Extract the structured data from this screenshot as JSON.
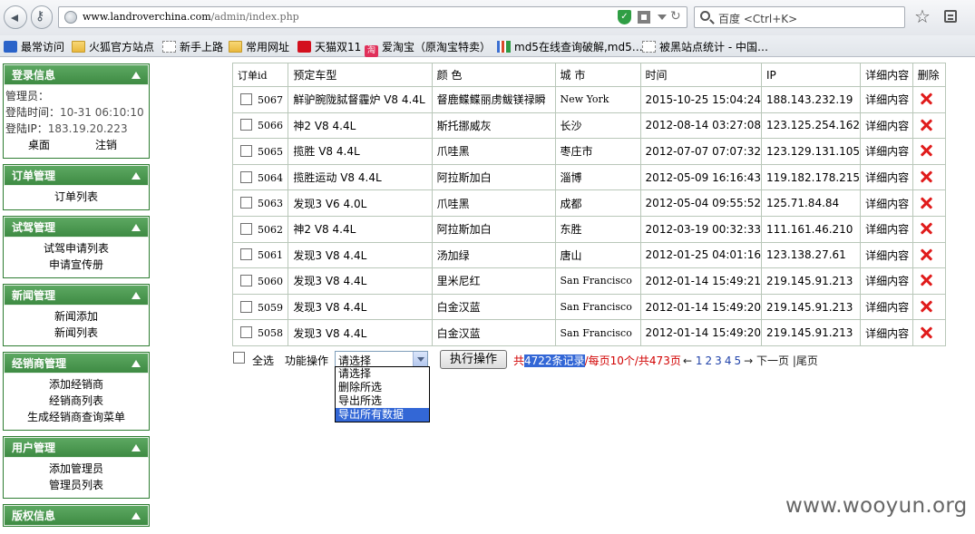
{
  "browser": {
    "url_domain": "www.landroverchina.com",
    "url_path": "/admin/index.php",
    "search_placeholder": "百度 <Ctrl+K>"
  },
  "bookmarks": [
    {
      "label": "最常访问",
      "icon": "star-bm"
    },
    {
      "label": "火狐官方站点",
      "icon": "folder"
    },
    {
      "label": "新手上路",
      "icon": "blank"
    },
    {
      "label": "常用网址",
      "icon": "folder"
    },
    {
      "label": "天猫双11",
      "icon": "tmall"
    },
    {
      "label": "爱淘宝（原淘宝特卖）",
      "icon": "taobao"
    },
    {
      "label": "md5在线查询破解,md5…",
      "icon": "grid"
    },
    {
      "label": "被黑站点统计 - 中国…",
      "icon": "blank"
    }
  ],
  "sidebar": {
    "login": {
      "title": "登录信息",
      "admin_label": "管理员：",
      "admin_value": "",
      "time_label": "登陆时间：",
      "time_value": "10-31 06:10:10",
      "ip_label": "登陆IP：",
      "ip_value": "183.19.20.223",
      "desktop_link": "桌面",
      "logout_link": "注销"
    },
    "panels": [
      {
        "title": "订单管理",
        "items": [
          "订单列表"
        ]
      },
      {
        "title": "试驾管理",
        "items": [
          "试驾申请列表",
          "申请宣传册"
        ]
      },
      {
        "title": "新闻管理",
        "items": [
          "新闻添加",
          "新闻列表"
        ]
      },
      {
        "title": "经销商管理",
        "items": [
          "添加经销商",
          "经销商列表",
          "生成经销商查询菜单"
        ]
      },
      {
        "title": "用户管理",
        "items": [
          "添加管理员",
          "管理员列表"
        ]
      },
      {
        "title": "版权信息",
        "items": []
      }
    ]
  },
  "table": {
    "headers": [
      "订单id",
      "预定车型",
      "颜 色",
      "城 市",
      "时间",
      "IP",
      "详细内容",
      "删除"
    ],
    "rows": [
      {
        "id": "5067",
        "model": "觧驴腕陇脦督霾炉 V8 4.4L",
        "color": "督鹿鲽鲽丽虏鲅镁禄瞬",
        "city": "New York",
        "time": "2015-10-25 15:04:24",
        "ip": "188.143.232.19",
        "detail": "详细内容"
      },
      {
        "id": "5066",
        "model": "神2 V8 4.4L",
        "color": "斯托挪威灰",
        "city": "长沙",
        "time": "2012-08-14 03:27:08",
        "ip": "123.125.254.162",
        "detail": "详细内容"
      },
      {
        "id": "5065",
        "model": "揽胜 V8 4.4L",
        "color": "爪哇黑",
        "city": "枣庄市",
        "time": "2012-07-07 07:07:32",
        "ip": "123.129.131.105",
        "detail": "详细内容"
      },
      {
        "id": "5064",
        "model": "揽胜运动 V8 4.4L",
        "color": "阿拉斯加白",
        "city": "淄博",
        "time": "2012-05-09 16:16:43",
        "ip": "119.182.178.215",
        "detail": "详细内容"
      },
      {
        "id": "5063",
        "model": "发现3 V6 4.0L",
        "color": "爪哇黑",
        "city": "成都",
        "time": "2012-05-04 09:55:52",
        "ip": "125.71.84.84",
        "detail": "详细内容"
      },
      {
        "id": "5062",
        "model": "神2 V8 4.4L",
        "color": "阿拉斯加白",
        "city": "东胜",
        "time": "2012-03-19 00:32:33",
        "ip": "111.161.46.210",
        "detail": "详细内容"
      },
      {
        "id": "5061",
        "model": "发现3 V8 4.4L",
        "color": "汤加绿",
        "city": "唐山",
        "time": "2012-01-25 04:01:16",
        "ip": "123.138.27.61",
        "detail": "详细内容"
      },
      {
        "id": "5060",
        "model": "发现3 V8 4.4L",
        "color": "里米尼红",
        "city": "San Francisco",
        "time": "2012-01-14 15:49:21",
        "ip": "219.145.91.213",
        "detail": "详细内容"
      },
      {
        "id": "5059",
        "model": "发现3 V8 4.4L",
        "color": "白金汉蓝",
        "city": "San Francisco",
        "time": "2012-01-14 15:49:20",
        "ip": "219.145.91.213",
        "detail": "详细内容"
      },
      {
        "id": "5058",
        "model": "发现3 V8 4.4L",
        "color": "白金汉蓝",
        "city": "San Francisco",
        "time": "2012-01-14 15:49:20",
        "ip": "219.145.91.213",
        "detail": "详细内容"
      }
    ]
  },
  "actions": {
    "select_all": "全选",
    "func_label": "功能操作",
    "select_value": "请选择",
    "options": [
      "请选择",
      "删除所选",
      "导出所选",
      "导出所有数据"
    ],
    "active_option_index": 3,
    "exec_button": "执行操作",
    "stats_prefix": "共",
    "stats_highlight": "4722条记录",
    "stats_suffix": "/每页10个/共473页",
    "pager_prev": "←",
    "pages": [
      "1",
      "2",
      "3",
      "4",
      "5"
    ],
    "pager_next_arrow": "→",
    "pager_next": "下一页",
    "pager_last": "|尾页"
  },
  "watermark": "www.wooyun.org",
  "colors": {
    "panel_header": "#4a964e",
    "delete": "#e01b1b",
    "stats": "#d10000",
    "highlight": "#3367d6"
  }
}
